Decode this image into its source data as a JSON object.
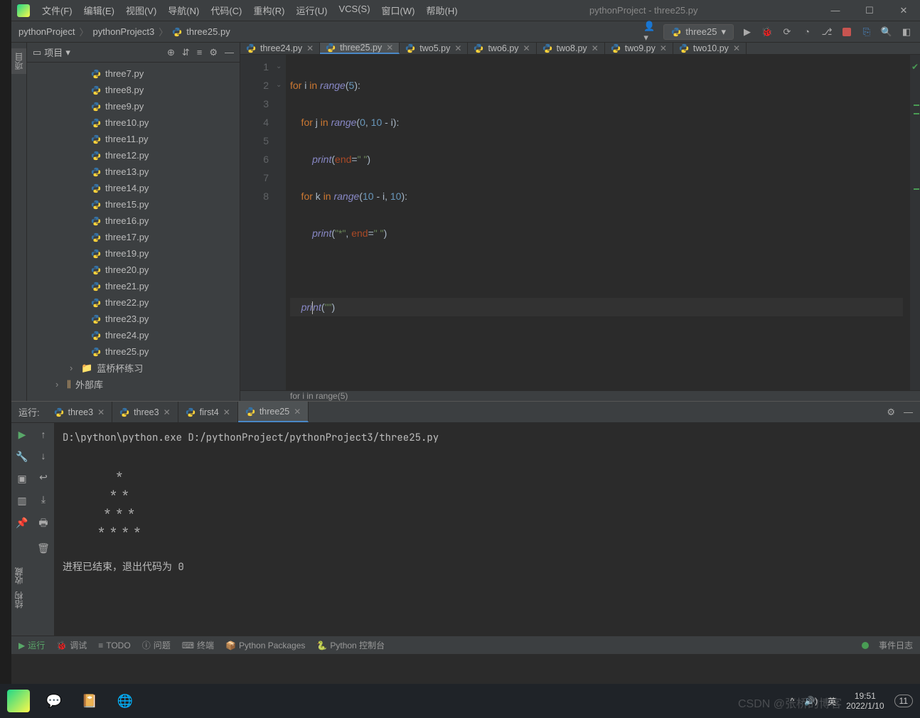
{
  "window": {
    "title": "pythonProject - three25.py",
    "menu": [
      "文件(F)",
      "编辑(E)",
      "视图(V)",
      "导航(N)",
      "代码(C)",
      "重构(R)",
      "运行(U)",
      "VCS(S)",
      "窗口(W)",
      "帮助(H)"
    ]
  },
  "breadcrumbs": [
    "pythonProject",
    "pythonProject3",
    "three25.py"
  ],
  "runConfig": "three25",
  "sidebar": {
    "label": "项目",
    "files": [
      "three7.py",
      "three8.py",
      "three9.py",
      "three10.py",
      "three11.py",
      "three12.py",
      "three13.py",
      "three14.py",
      "three15.py",
      "three16.py",
      "three17.py",
      "three19.py",
      "three20.py",
      "three21.py",
      "three22.py",
      "three23.py",
      "three24.py",
      "three25.py"
    ],
    "folder": "蓝桥杯练习",
    "external": "外部库"
  },
  "leftGutter": {
    "top": "项目",
    "struct": "结构",
    "fav": "收藏"
  },
  "editor": {
    "tabs": [
      {
        "name": "three24.py",
        "active": false
      },
      {
        "name": "three25.py",
        "active": true
      },
      {
        "name": "two5.py",
        "active": false
      },
      {
        "name": "two6.py",
        "active": false
      },
      {
        "name": "two8.py",
        "active": false
      },
      {
        "name": "two9.py",
        "active": false
      },
      {
        "name": "two10.py",
        "active": false
      }
    ],
    "lineNumbers": [
      "1",
      "2",
      "3",
      "4",
      "5",
      "6",
      "7",
      "8"
    ],
    "breadcrumb": "for i in range(5)"
  },
  "code": {
    "l1": {
      "a": "for ",
      "b": "i ",
      "c": "in ",
      "d": "range",
      "e": "(",
      "f": "5",
      "g": "):"
    },
    "l2": {
      "a": "    for ",
      "b": "j ",
      "c": "in ",
      "d": "range",
      "e": "(",
      "f": "0",
      "g": ", ",
      "h": "10 ",
      "i": "- i):"
    },
    "l3": {
      "a": "        ",
      "b": "print",
      "c": "(",
      "d": "end",
      "e": "=",
      "f": "\" \"",
      "g": ")"
    },
    "l4": {
      "a": "    for ",
      "b": "k ",
      "c": "in ",
      "d": "range",
      "e": "(",
      "f": "10 ",
      "g": "- i, ",
      "h": "10",
      "i": "):"
    },
    "l5": {
      "a": "        ",
      "b": "print",
      "c": "(",
      "d": "\"*\"",
      "e": ", ",
      "f": "end",
      "g": "=",
      "h": "\" \"",
      "i": ")"
    },
    "l7": {
      "a": "    ",
      "b": "pri",
      "c": "nt",
      "d": "(",
      "e": "\"\"",
      "f": ")"
    }
  },
  "runPanel": {
    "label": "运行:",
    "tabs": [
      {
        "name": "three3",
        "active": false
      },
      {
        "name": "three3",
        "active": false
      },
      {
        "name": "first4",
        "active": false
      },
      {
        "name": "three25",
        "active": true
      }
    ],
    "output": "D:\\python\\python.exe D:/pythonProject/pythonProject3/three25.py\n\n         *\n        * *\n       * * *\n      * * * *\n\n进程已结束，退出代码为 0"
  },
  "statusBar": {
    "run": "运行",
    "debug": "调试",
    "todo": "TODO",
    "problems": "问题",
    "terminal": "终端",
    "pkgs": "Python Packages",
    "console": "Python 控制台",
    "eventlog": "事件日志"
  },
  "taskbar": {
    "ime": "英",
    "time": "19:51",
    "date": "2022/1/10",
    "badge": "11"
  },
  "watermark": "CSDN @张桥的博客"
}
